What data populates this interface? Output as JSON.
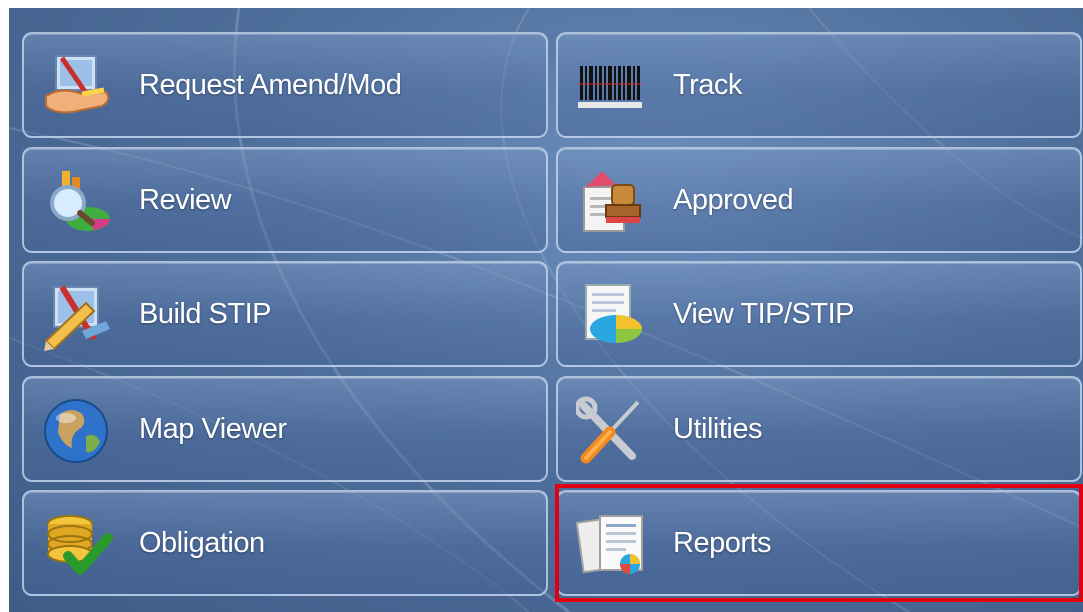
{
  "menu": {
    "items": [
      {
        "label": "Request Amend/Mod",
        "icon": "hand-pencil-icon"
      },
      {
        "label": "Track",
        "icon": "barcode-icon"
      },
      {
        "label": "Review",
        "icon": "magnifier-chart-icon"
      },
      {
        "label": "Approved",
        "icon": "stamp-icon"
      },
      {
        "label": "Build STIP",
        "icon": "pencil-ruler-icon"
      },
      {
        "label": "View TIP/STIP",
        "icon": "document-pie-icon"
      },
      {
        "label": "Map Viewer",
        "icon": "globe-icon"
      },
      {
        "label": "Utilities",
        "icon": "wrench-screwdriver-icon"
      },
      {
        "label": "Obligation",
        "icon": "coins-check-icon"
      },
      {
        "label": "Reports",
        "icon": "report-document-icon"
      }
    ],
    "selected": "Reports"
  },
  "colors": {
    "background": "#4f6f9c",
    "tile_border": "#cddcf0",
    "label_text": "#ffffff",
    "selection_outline": "#e0000f"
  }
}
